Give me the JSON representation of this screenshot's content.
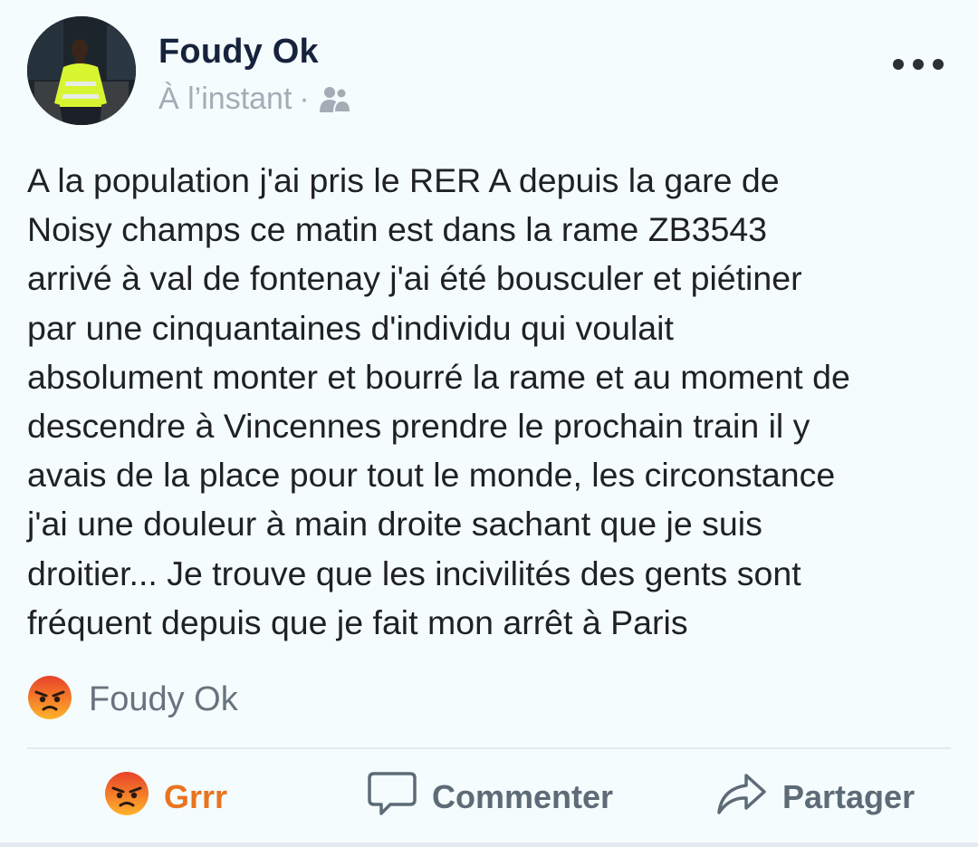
{
  "post": {
    "author": {
      "name": "Foudy Ok",
      "avatar_icon": "profile-photo"
    },
    "meta": {
      "timestamp": "À l’instant",
      "separator": "·",
      "audience_icon": "friends-icon"
    },
    "more_icon": "more-options-icon",
    "body": "A la population j'ai pris le RER A depuis la gare de\nNoisy champs ce matin est dans la rame ZB3543\narrivé à val de fontenay j'ai été bousculer et piétiner\npar une cinquantaines d'individu qui voulait\nabsolument monter et bourré la rame et au moment de\ndescendre à Vincennes prendre le prochain train il y\navais de la place pour tout le monde, les circonstance\nj'ai une douleur à main droite sachant que je suis\ndroitier... Je trouve que les incivilités des gents sont\nfréquent depuis que je fait mon arrêt à Paris",
    "reactions": {
      "icon": "angry-emoji-icon",
      "text": "Foudy Ok"
    },
    "actions": {
      "react_label": "Grrr",
      "comment_label": "Commenter",
      "share_label": "Partager"
    },
    "colors": {
      "background": "#f4fcfd",
      "author_name": "#17233d",
      "meta_text": "#a4acb6",
      "action_text": "#5d6b77",
      "active_reaction": "#e9741f",
      "divider": "#e3eaef"
    }
  }
}
